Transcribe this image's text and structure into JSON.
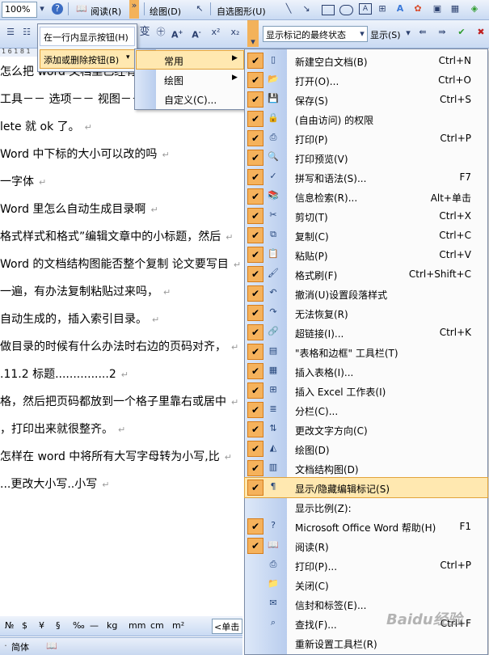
{
  "toolbar1": {
    "zoom": "100%",
    "read_label": "阅读(R)",
    "draw_label": "绘图(D)",
    "autoshapes_label": "自选图形(U)"
  },
  "toolbar2": {
    "show_one_row": "在一行内显示按钮(H)",
    "show_final": "显示标记的最终状态",
    "show_label": "显示(S)"
  },
  "ruler_text": "1 6  1 8  1",
  "submenu1": {
    "add_remove": "添加或删除按钮(B)"
  },
  "submenu2": {
    "items": [
      "常用",
      "绘图",
      "自定义(C)..."
    ]
  },
  "menu_items": [
    {
      "label": "新建空白文档(B)",
      "shortcut": "Ctrl+N",
      "icon": "new-doc-icon"
    },
    {
      "label": "打开(O)...",
      "shortcut": "Ctrl+O",
      "icon": "open-folder-icon"
    },
    {
      "label": "保存(S)",
      "shortcut": "Ctrl+S",
      "icon": "save-icon"
    },
    {
      "label": "(自由访问) 的权限",
      "shortcut": "",
      "icon": "permission-icon"
    },
    {
      "label": "打印(P)",
      "shortcut": "Ctrl+P",
      "icon": "print-icon"
    },
    {
      "label": "打印预览(V)",
      "shortcut": "",
      "icon": "print-preview-icon"
    },
    {
      "label": "拼写和语法(S)...",
      "shortcut": "F7",
      "icon": "spelling-icon"
    },
    {
      "label": "信息检索(R)...",
      "shortcut": "Alt+单击",
      "icon": "research-icon"
    },
    {
      "label": "剪切(T)",
      "shortcut": "Ctrl+X",
      "icon": "cut-icon"
    },
    {
      "label": "复制(C)",
      "shortcut": "Ctrl+C",
      "icon": "copy-icon"
    },
    {
      "label": "粘贴(P)",
      "shortcut": "Ctrl+V",
      "icon": "paste-icon"
    },
    {
      "label": "格式刷(F)",
      "shortcut": "Ctrl+Shift+C",
      "icon": "format-painter-icon"
    },
    {
      "label": "撤消(U)设置段落样式",
      "shortcut": "",
      "icon": "undo-icon"
    },
    {
      "label": "无法恢复(R)",
      "shortcut": "",
      "icon": "redo-icon"
    },
    {
      "label": "超链接(I)...",
      "shortcut": "Ctrl+K",
      "icon": "hyperlink-icon"
    },
    {
      "label": "\"表格和边框\" 工具栏(T)",
      "shortcut": "",
      "icon": "tables-borders-icon"
    },
    {
      "label": "插入表格(I)...",
      "shortcut": "",
      "icon": "insert-table-icon"
    },
    {
      "label": "插入 Excel 工作表(I)",
      "shortcut": "",
      "icon": "excel-icon"
    },
    {
      "label": "分栏(C)...",
      "shortcut": "",
      "icon": "columns-icon"
    },
    {
      "label": "更改文字方向(C)",
      "shortcut": "",
      "icon": "text-direction-icon"
    },
    {
      "label": "绘图(D)",
      "shortcut": "",
      "icon": "drawing-icon"
    },
    {
      "label": "文档结构图(D)",
      "shortcut": "",
      "icon": "document-map-icon"
    },
    {
      "label": "显示/隐藏编辑标记(S)",
      "shortcut": "",
      "icon": "show-hide-marks-icon",
      "highlighted": true
    },
    {
      "label": "显示比例(Z):",
      "shortcut": "",
      "icon": "",
      "unchecked": true
    },
    {
      "label": "Microsoft Office Word 帮助(H)",
      "shortcut": "F1",
      "icon": "help-icon"
    },
    {
      "label": "阅读(R)",
      "shortcut": "",
      "icon": "read-icon"
    },
    {
      "label": "打印(P)...",
      "shortcut": "Ctrl+P",
      "icon": "print-dialog-icon",
      "unchecked": true
    },
    {
      "label": "关闭(C)",
      "shortcut": "",
      "icon": "close-folder-icon",
      "unchecked": true
    },
    {
      "label": "信封和标签(E)...",
      "shortcut": "",
      "icon": "envelope-icon",
      "unchecked": true
    },
    {
      "label": "查找(F)...",
      "shortcut": "Ctrl+F",
      "icon": "find-icon",
      "unchecked": true
    },
    {
      "label": "重新设置工具栏(R)",
      "shortcut": "",
      "icon": "",
      "unchecked": true
    }
  ],
  "document_lines": [
    "怎么把 word 文档里已经有的分页符去掉，",
    "工具－－ 选项－－ 视图－－ 格式标记，选",
    "lete 就 ok 了。",
    "Word 中下标的大小可以改的吗",
    "一字体",
    "Word 里怎么自动生成目录啊",
    "格式样式和格式”编辑文章中的小标题，然后",
    "Word 的文档结构图能否整个复制 论文要写目",
    "一遍，有办法复制粘贴过来吗，",
    "自动生成的，插入索引目录。",
    "做目录的时候有什么办法时右边的页码对齐，",
    ".11.2 标题...............2",
    "格，然后把页码都放到一个格子里靠右或居中",
    "，打印出来就很整齐。",
    "怎样在 word 中将所有大写字母转为小写,比",
    "...更改大小写..小写"
  ],
  "bottom_toolbar": {
    "symbols": [
      "№",
      "$",
      "¥",
      "§",
      "‰",
      "—",
      "kg",
      "mm",
      "cm",
      "m²"
    ],
    "input_text": "<单击"
  },
  "status_bar": {
    "language": "简体"
  },
  "watermark": "Baidu经验"
}
